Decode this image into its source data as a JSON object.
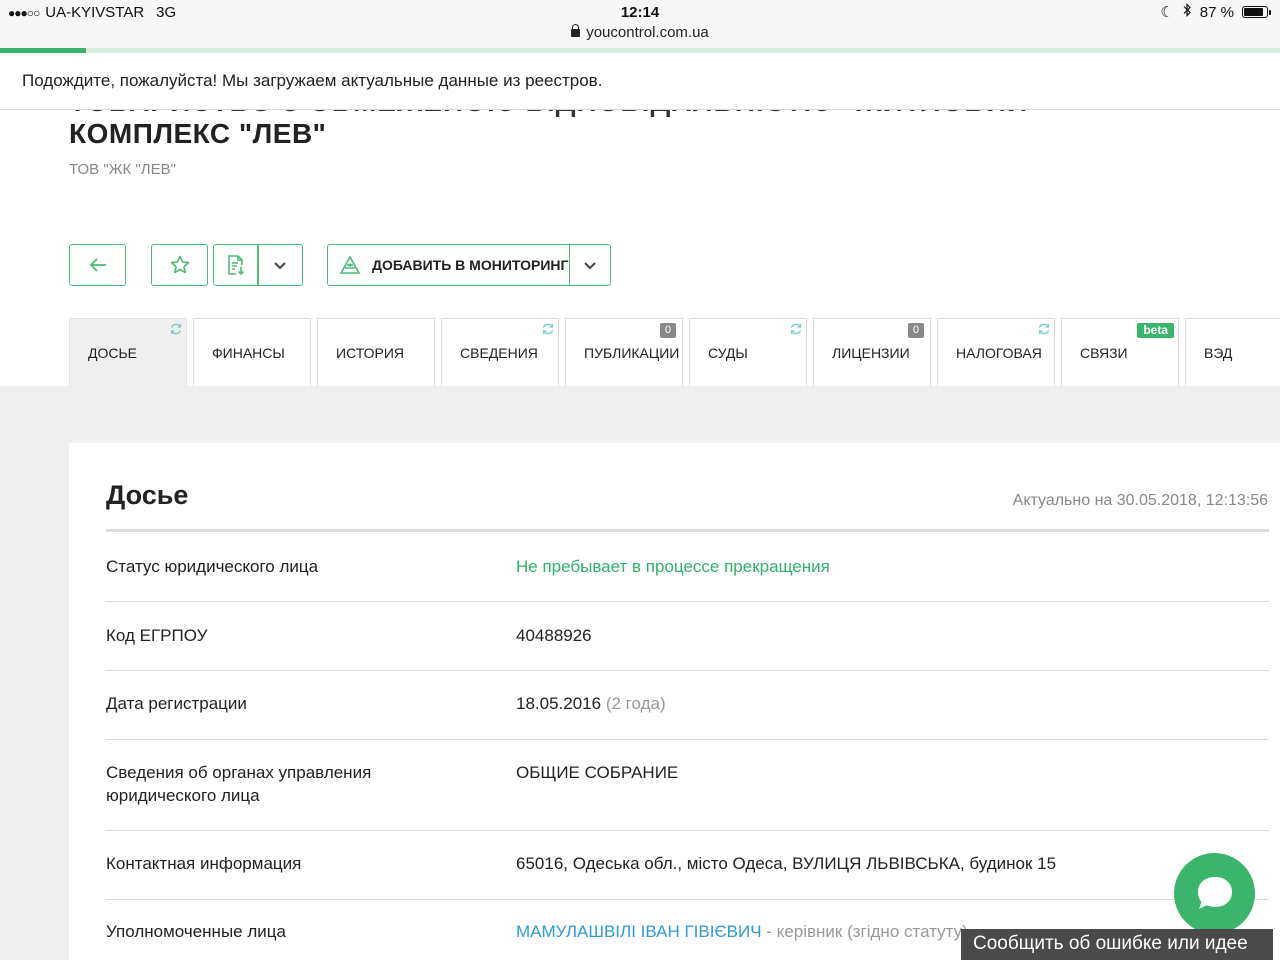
{
  "status_bar": {
    "carrier": "UA-KYIVSTAR",
    "network": "3G",
    "time": "12:14",
    "battery_text": "87 %",
    "battery_level": 0.87
  },
  "url_bar": {
    "domain": "youcontrol.com.ua"
  },
  "page_progress": 0.067,
  "loading_banner": "Подождите, пожалуйста! Мы загружаем актуальные данные из реестров.",
  "company": {
    "title_cut": "ТОВАРИСТВО З ОБМЕЖЕНОЮ ВІДПОВІДАЛЬНІСТЮ \"ЖИТЛОВИЙ",
    "title": "КОМПЛЕКС \"ЛЕВ\"",
    "short_name": "ТОВ \"ЖК \"ЛЕВ\""
  },
  "toolbar": {
    "monitor_label": "ДОБАВИТЬ В МОНИТОРИНГ"
  },
  "tabs": [
    {
      "label": "ДОСЬЕ",
      "active": true,
      "refresh": true
    },
    {
      "label": "ФИНАНСЫ"
    },
    {
      "label": "ИСТОРИЯ"
    },
    {
      "label": "СВЕДЕНИЯ",
      "refresh": true
    },
    {
      "label": "ПУБЛИКАЦИИ",
      "count": "0"
    },
    {
      "label": "СУДЫ",
      "refresh": true
    },
    {
      "label": "ЛИЦЕНЗИИ",
      "count": "0"
    },
    {
      "label": "НАЛОГОВАЯ",
      "refresh": true
    },
    {
      "label": "СВЯЗИ",
      "badge": "beta"
    },
    {
      "label": "ВЭД"
    }
  ],
  "dossier": {
    "title": "Досье",
    "updated": "Актуально на 30.05.2018, 12:13:56",
    "rows": [
      {
        "label": "Статус юридического лица",
        "value": "Не пребывает в процессе прекращения"
      },
      {
        "label": "Код ЕГРПОУ",
        "value": "40488926"
      },
      {
        "label": "Дата регистрации",
        "value": "18.05.2016",
        "note": "(2 года)"
      },
      {
        "label": "Сведения об органах управления юридического лица",
        "value": "ОБЩИЕ СОБРАНИЕ"
      },
      {
        "label": "Контактная информация",
        "value": "65016, Одеська обл., місто Одеса, ВУЛИЦЯ ЛЬВІВСЬКА, будинок 15"
      },
      {
        "label": "Уполномоченные лица",
        "link": "МАМУЛАШВІЛІ ІВАН ГІВІЄВИЧ",
        "value": " - керівник (згідно статуту)"
      }
    ]
  },
  "feedback_label": "Сообщить об ошибке или идее",
  "colors": {
    "accent": "#3ab56b",
    "link": "#2f9bd6",
    "status_green": "#2eb36a"
  }
}
